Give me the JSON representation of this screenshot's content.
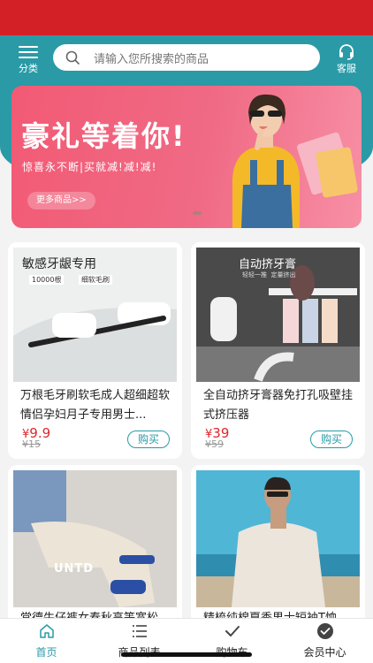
{
  "header": {
    "category_label": "分类",
    "search_placeholder": "请输入您所搜索的商品",
    "service_label": "客服",
    "brand_color": "#2a9aa6",
    "status_bar_color": "#d32027"
  },
  "banner": {
    "title": "豪礼等着你!",
    "subtitle": "惊喜永不断|买就减!减!减!",
    "more_label": "更多商品>>"
  },
  "products": [
    {
      "name": "万根毛牙刷软毛成人超细超软情侣孕妇月子专用男士...",
      "price_symbol": "¥",
      "price": "9.9",
      "old_price": "¥15",
      "buy_label": "购买",
      "img_text_1": "敏感牙龈专用",
      "img_text_2": "10000根",
      "img_text_3": "细软毛刷"
    },
    {
      "name": "全自动挤牙膏器免打孔吸壁挂式挤压器",
      "price_symbol": "¥",
      "price": "39",
      "old_price": "¥59",
      "buy_label": "购买",
      "img_text_1": "自动挤牙膏",
      "img_text_2": "轻轻一推  定量挤出"
    },
    {
      "name": "堂德牛仔裤女春秋高等宽松",
      "img_text_1": "UNTD"
    },
    {
      "name": "精梳纯棉夏季男士短袖T恤"
    }
  ],
  "tabbar": {
    "items": [
      {
        "label": "首页",
        "icon": "home-icon"
      },
      {
        "label": "商品列表",
        "icon": "list-icon"
      },
      {
        "label": "购物车",
        "icon": "check-icon"
      },
      {
        "label": "会员中心",
        "icon": "member-icon"
      }
    ]
  }
}
